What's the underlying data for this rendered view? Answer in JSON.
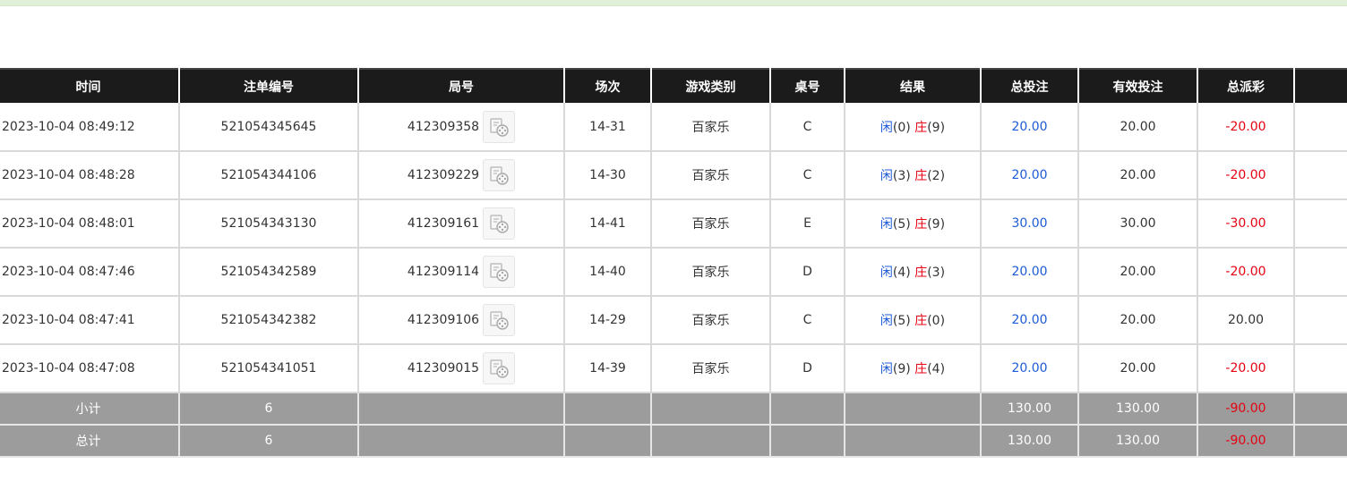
{
  "headers": [
    "时间",
    "注单编号",
    "局号",
    "场次",
    "游戏类别",
    "桌号",
    "结果",
    "总投注",
    "有效投注",
    "总派彩",
    ""
  ],
  "rows": [
    {
      "time": "2023-10-04 08:49:12",
      "bet_id": "521054345645",
      "round": "412309358",
      "session": "14-31",
      "game": "百家乐",
      "table": "C",
      "player_label": "闲",
      "player_score": "(0)",
      "banker_label": "庄",
      "banker_score": "(9)",
      "total_bet": "20.00",
      "valid_bet": "20.00",
      "payout": "-20.00",
      "payout_neg": true
    },
    {
      "time": "2023-10-04 08:48:28",
      "bet_id": "521054344106",
      "round": "412309229",
      "session": "14-30",
      "game": "百家乐",
      "table": "C",
      "player_label": "闲",
      "player_score": "(3)",
      "banker_label": "庄",
      "banker_score": "(2)",
      "total_bet": "20.00",
      "valid_bet": "20.00",
      "payout": "-20.00",
      "payout_neg": true
    },
    {
      "time": "2023-10-04 08:48:01",
      "bet_id": "521054343130",
      "round": "412309161",
      "session": "14-41",
      "game": "百家乐",
      "table": "E",
      "player_label": "闲",
      "player_score": "(5)",
      "banker_label": "庄",
      "banker_score": "(9)",
      "total_bet": "30.00",
      "valid_bet": "30.00",
      "payout": "-30.00",
      "payout_neg": true
    },
    {
      "time": "2023-10-04 08:47:46",
      "bet_id": "521054342589",
      "round": "412309114",
      "session": "14-40",
      "game": "百家乐",
      "table": "D",
      "player_label": "闲",
      "player_score": "(4)",
      "banker_label": "庄",
      "banker_score": "(3)",
      "total_bet": "20.00",
      "valid_bet": "20.00",
      "payout": "-20.00",
      "payout_neg": true
    },
    {
      "time": "2023-10-04 08:47:41",
      "bet_id": "521054342382",
      "round": "412309106",
      "session": "14-29",
      "game": "百家乐",
      "table": "C",
      "player_label": "闲",
      "player_score": "(5)",
      "banker_label": "庄",
      "banker_score": "(0)",
      "total_bet": "20.00",
      "valid_bet": "20.00",
      "payout": "20.00",
      "payout_neg": false
    },
    {
      "time": "2023-10-04 08:47:08",
      "bet_id": "521054341051",
      "round": "412309015",
      "session": "14-39",
      "game": "百家乐",
      "table": "D",
      "player_label": "闲",
      "player_score": "(9)",
      "banker_label": "庄",
      "banker_score": "(4)",
      "total_bet": "20.00",
      "valid_bet": "20.00",
      "payout": "-20.00",
      "payout_neg": true
    }
  ],
  "subtotal": {
    "label": "小计",
    "count": "6",
    "total_bet": "130.00",
    "valid_bet": "130.00",
    "payout": "-90.00"
  },
  "total": {
    "label": "总计",
    "count": "6",
    "total_bet": "130.00",
    "valid_bet": "130.00",
    "payout": "-90.00"
  },
  "icons": {
    "replay": "video-replay-icon"
  },
  "colors": {
    "header_bg": "#1b1b1b",
    "player": "#1e5bd6",
    "banker": "#e60012",
    "negative": "#e60012",
    "summary_bg": "#9c9c9c"
  }
}
